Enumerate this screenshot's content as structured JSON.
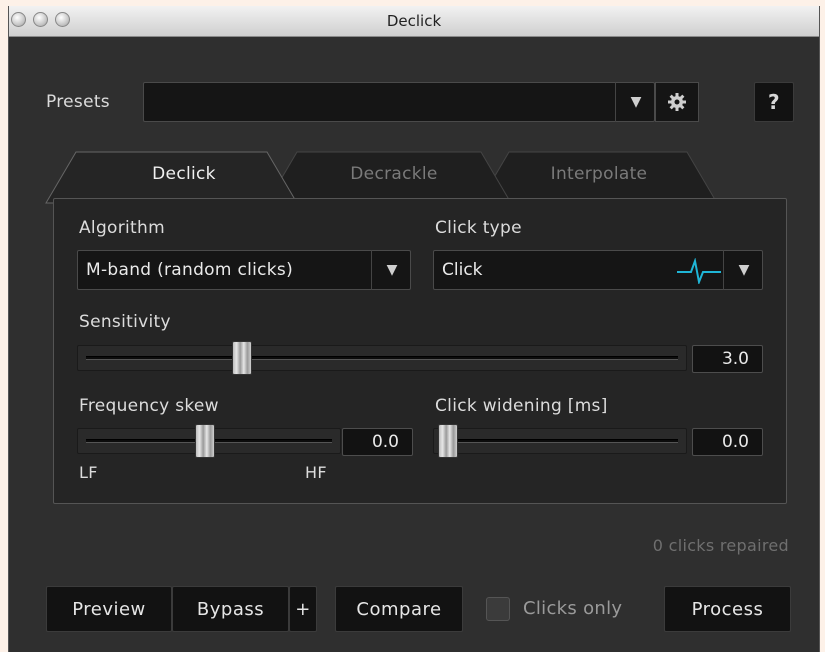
{
  "window": {
    "title": "Declick"
  },
  "presets": {
    "label": "Presets",
    "value": "",
    "help": "?"
  },
  "tabs": [
    {
      "label": "Declick",
      "active": true
    },
    {
      "label": "Decrackle",
      "active": false
    },
    {
      "label": "Interpolate",
      "active": false
    }
  ],
  "algorithm": {
    "label": "Algorithm",
    "value": "M-band (random clicks)"
  },
  "click_type": {
    "label": "Click type",
    "value": "Click",
    "icon": "click-waveform-icon"
  },
  "sensitivity": {
    "label": "Sensitivity",
    "value": "3.0",
    "level": 0.27
  },
  "frequency_skew": {
    "label": "Frequency skew",
    "value": "0.0",
    "level": 0.5,
    "min_label": "LF",
    "max_label": "HF"
  },
  "click_widening": {
    "label": "Click widening [ms]",
    "value": "0.0",
    "level": 0.0
  },
  "status": {
    "text": "0 clicks repaired"
  },
  "buttons": {
    "preview": "Preview",
    "bypass": "Bypass",
    "plus": "+",
    "compare": "Compare",
    "clicks_only": "Clicks only",
    "process": "Process"
  },
  "colors": {
    "accent": "#1fb5d6",
    "panel": "#252525",
    "window": "#2f2f2f"
  }
}
